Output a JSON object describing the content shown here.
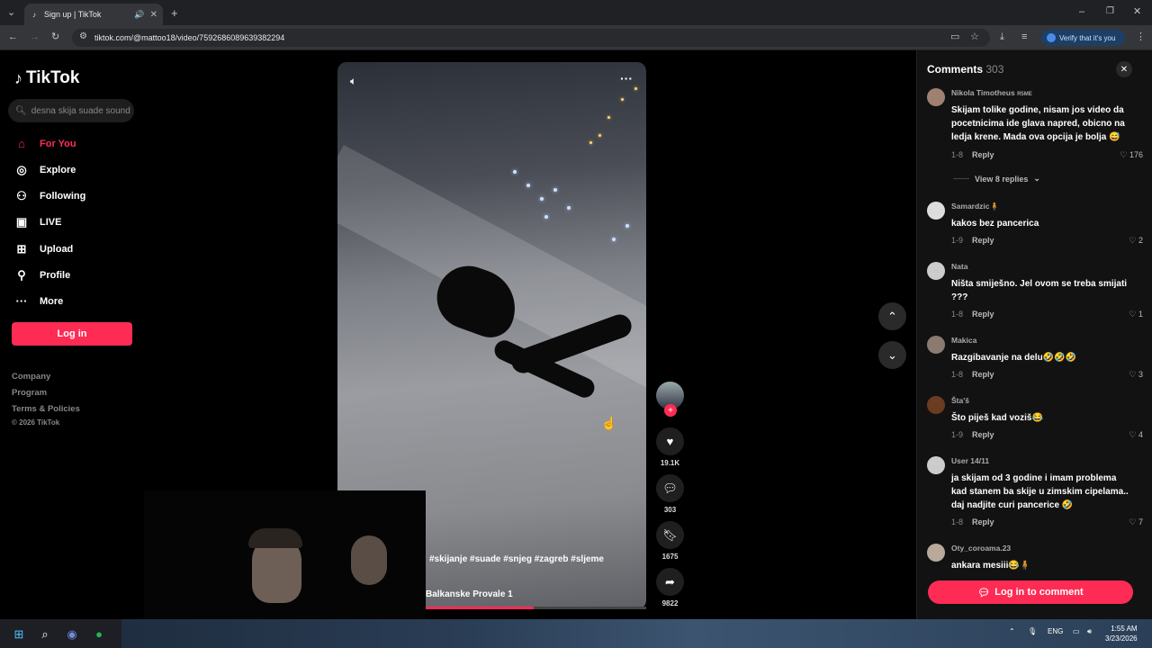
{
  "browser": {
    "tab_title": "Sign up | TikTok",
    "url": "tiktok.com/@mattoo18/video/7592686089639382294",
    "verify_label": "Verify that it's you"
  },
  "sidebar": {
    "brand": "TikTok",
    "search_placeholder": "desna skija suade sound",
    "nav": [
      {
        "label": "For You",
        "icon": "home-icon",
        "active": true
      },
      {
        "label": "Explore",
        "icon": "compass-icon"
      },
      {
        "label": "Following",
        "icon": "following-icon"
      },
      {
        "label": "LIVE",
        "icon": "live-icon"
      },
      {
        "label": "Upload",
        "icon": "upload-icon"
      },
      {
        "label": "Profile",
        "icon": "profile-icon"
      },
      {
        "label": "More",
        "icon": "more-icon"
      }
    ],
    "login_label": "Log in",
    "footer": [
      "Company",
      "Program",
      "Terms & Policies",
      "© 2026 TikTok"
    ]
  },
  "video": {
    "caption": "#skijanje #suade #snjeg #zagreb #sljeme",
    "music": "Balkanske Provale 1",
    "progress_fraction": 0.49,
    "likes": "19.1K",
    "comments": "303",
    "saves": "1675",
    "shares": "9822"
  },
  "comments": {
    "title": "Comments",
    "count": "303",
    "login_label": "Log in to comment",
    "view_replies": "View 8 replies",
    "items": [
      {
        "user": "Nikola Timotheus",
        "badge": "R5ME",
        "text": "Skijam tolike godine, nisam jos video da pocetnicima ide glava napred, obicno na ledja krene. Mada ova opcija je bolja 😅",
        "date": "1-8",
        "reply": "Reply",
        "likes": "176"
      },
      {
        "user": "Samardzic🧍",
        "text": "kakos bez pancerica",
        "date": "1-9",
        "reply": "Reply",
        "likes": "2"
      },
      {
        "user": "Nata",
        "text": "Ništa smiješno. Jel ovom se treba smijati ???",
        "date": "1-8",
        "reply": "Reply",
        "likes": "1"
      },
      {
        "user": "Makica",
        "text": "Razgibavanje na delu🤣🤣🤣",
        "date": "1-8",
        "reply": "Reply",
        "likes": "3"
      },
      {
        "user": "Šta'š",
        "text": "Što piješ kad voziš😂",
        "date": "1-9",
        "reply": "Reply",
        "likes": "4"
      },
      {
        "user": "User 14/11",
        "text": "ja skijam od 3 godine i imam problema kad stanem ba skije u zimskim cipelama.. daj nadjite curi pancerice 🤣",
        "date": "1-8",
        "reply": "Reply",
        "likes": "7"
      },
      {
        "user": "Oty_coroama.23",
        "text": "ankara mesiii😂🧍",
        "date": "",
        "reply": "",
        "likes": ""
      }
    ]
  },
  "taskbar": {
    "lang": "ENG",
    "time": "1:55 AM",
    "date": "3/23/2026"
  }
}
